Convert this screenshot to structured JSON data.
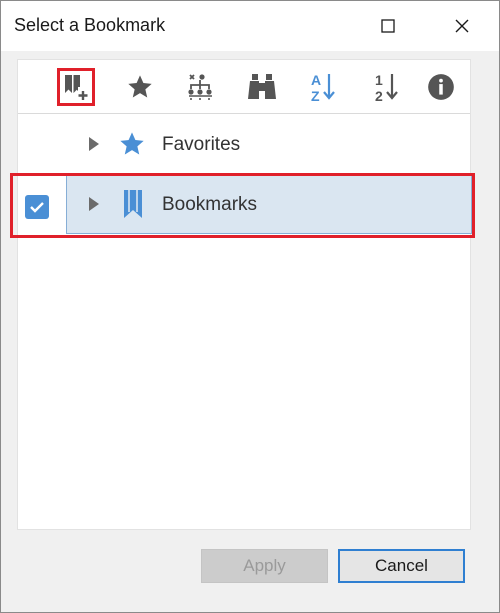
{
  "window": {
    "title": "Select a Bookmark",
    "controls": [
      "maximize-icon",
      "close-icon"
    ]
  },
  "toolbar": {
    "tools": [
      {
        "name": "add-bookmark-icon",
        "selected": true
      },
      {
        "name": "favorite-star-icon"
      },
      {
        "name": "hierarchy-icon"
      },
      {
        "name": "binoculars-icon"
      },
      {
        "name": "sort-az-icon"
      },
      {
        "name": "sort-12-icon"
      },
      {
        "name": "info-icon"
      }
    ],
    "az_text": {
      "a": "A",
      "z": "Z"
    },
    "num_text": {
      "one": "1",
      "two": "2"
    }
  },
  "tree": {
    "items": [
      {
        "label": "Favorites",
        "icon": "star-icon",
        "checked": false
      },
      {
        "label": "Bookmarks",
        "icon": "bookmark-icon",
        "checked": true,
        "selected": true
      }
    ]
  },
  "buttons": {
    "apply": "Apply",
    "cancel": "Cancel"
  },
  "colors": {
    "accent": "#4a8fd5",
    "highlight": "#dae6f1",
    "annotation_red": "#e0202a"
  }
}
